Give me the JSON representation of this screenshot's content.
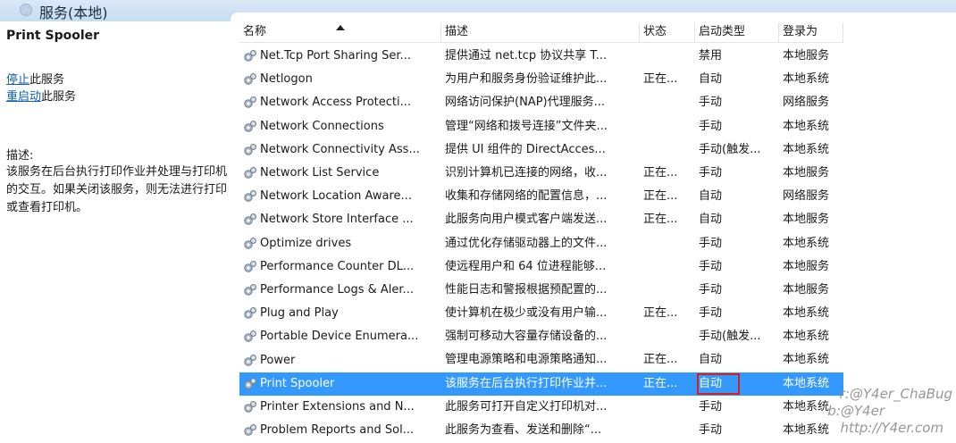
{
  "header": {
    "title": "服务(本地)"
  },
  "description_pane": {
    "service_name": "Print Spooler",
    "stop_link": "停止",
    "stop_suffix": "此服务",
    "restart_link": "重启动",
    "restart_suffix": "此服务",
    "desc_label": "描述:",
    "desc_text": "该服务在后台执行打印作业并处理与打印机的交互。如果关闭该服务，则无法进行打印或查看打印机。"
  },
  "columns": [
    "名称",
    "描述",
    "状态",
    "启动类型",
    "登录为"
  ],
  "rows": [
    {
      "name": "Net.Tcp Port Sharing Ser...",
      "desc": "提供通过 net.tcp 协议共享 T...",
      "status": "",
      "start": "禁用",
      "logon": "本地服务"
    },
    {
      "name": "Netlogon",
      "desc": "为用户和服务身份验证维护此...",
      "status": "正在...",
      "start": "自动",
      "logon": "本地系统"
    },
    {
      "name": "Network Access Protecti...",
      "desc": "网络访问保护(NAP)代理服务...",
      "status": "",
      "start": "手动",
      "logon": "网络服务"
    },
    {
      "name": "Network Connections",
      "desc": "管理“网络和拨号连接”文件夹...",
      "status": "",
      "start": "手动",
      "logon": "本地系统"
    },
    {
      "name": "Network Connectivity Ass...",
      "desc": "提供 UI 组件的 DirectAcces...",
      "status": "",
      "start": "手动(触发...",
      "logon": "本地系统"
    },
    {
      "name": "Network List Service",
      "desc": "识别计算机已连接的网络，收...",
      "status": "正在...",
      "start": "手动",
      "logon": "本地服务"
    },
    {
      "name": "Network Location Aware...",
      "desc": "收集和存储网络的配置信息，...",
      "status": "正在...",
      "start": "自动",
      "logon": "网络服务"
    },
    {
      "name": "Network Store Interface ...",
      "desc": "此服务向用户模式客户端发送...",
      "status": "正在...",
      "start": "自动",
      "logon": "本地服务"
    },
    {
      "name": "Optimize drives",
      "desc": "通过优化存储驱动器上的文件...",
      "status": "",
      "start": "手动",
      "logon": "本地系统"
    },
    {
      "name": "Performance Counter DL...",
      "desc": "使远程用户和 64 位进程能够...",
      "status": "",
      "start": "手动",
      "logon": "本地服务"
    },
    {
      "name": "Performance Logs & Aler...",
      "desc": "性能日志和警报根据预配置的...",
      "status": "",
      "start": "手动",
      "logon": "本地服务"
    },
    {
      "name": "Plug and Play",
      "desc": "使计算机在极少或没有用户输...",
      "status": "正在...",
      "start": "手动",
      "logon": "本地系统"
    },
    {
      "name": "Portable Device Enumera...",
      "desc": "强制可移动大容量存储设备的...",
      "status": "",
      "start": "手动(触发...",
      "logon": "本地系统"
    },
    {
      "name": "Power",
      "desc": "管理电源策略和电源策略通知...",
      "status": "正在...",
      "start": "自动",
      "logon": "本地系统"
    },
    {
      "name": "Print Spooler",
      "desc": "该服务在后台执行打印作业并...",
      "status": "正在...",
      "start": "自动",
      "logon": "本地系统"
    },
    {
      "name": "Printer Extensions and N...",
      "desc": "此服务可打开自定义打印机对...",
      "status": "",
      "start": "手动",
      "logon": "本地系统"
    },
    {
      "name": "Problem Reports and Sol...",
      "desc": "此服务为查看、发送和删除“...",
      "status": "",
      "start": "手动",
      "logon": "本地系统"
    }
  ],
  "selected_index": 14,
  "watermark": {
    "line1": "r:@Y4er_ChaBug",
    "line2": "b:@Y4er",
    "line3": "http://Y4er.com"
  },
  "colors": {
    "selection": "#3399ff",
    "highlight_box": "#d0202a",
    "link": "#0b5fb8"
  }
}
